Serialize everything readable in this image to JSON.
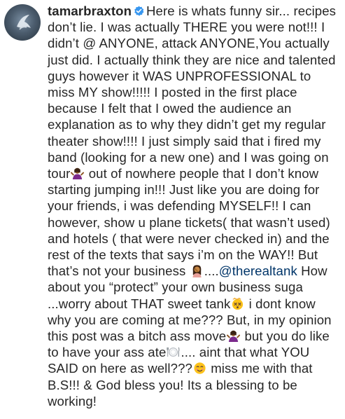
{
  "comment": {
    "username": "tamarbraxton",
    "verified_icon": "verified-badge-icon",
    "accent_color": "#3897f0",
    "mention_color": "#003569",
    "segments": {
      "s1": "Here is whats funny sir... recipes don’t lie. I was actually THERE you were not!!! I didn’t @ ANYONE, attack ANYONE,You actually just did. I actually think they are nice and talented guys however it WAS UNPROFESSIONAL to miss MY show!!!!! I posted in the first place because I felt that I owed the audience an explanation as to why they didn’t get my regular theater show!!!! I just simply said that i fired my band (looking for a new one) and I was going on tour",
      "s2": " out of nowhere people that I don’t know starting jumping in!!! Just like you are doing for your friends, i was defending MYSELF!! I can however, show u plane tickets( that wasn’t used) and hotels ( that were never checked in) and the rest of the texts that says i’m on the WAY!! But that’s not your business ",
      "s3": "....",
      "mention": "@therealtank",
      "s4": " How about you “protect” your own business suga ...worry about THAT sweet tank",
      "s5": " i dont know why you are coming at me??? But, in my opinion this post was a bitch ass move",
      "s6": " but you do like to have your ass ate",
      "s7": ".... aint that what YOU SAID on here as well???",
      "s8": " miss me with that B.S!!! & God bless you! Its a blessing to be working!"
    },
    "emoji_icons": {
      "e1": "woman-shrugging-icon",
      "e2": "woman-facepalming-icon",
      "e3": "dizzy-face-icon",
      "e4": "woman-shrugging-icon",
      "e5": "fork-knife-plate-icon",
      "e6": "smiling-face-icon"
    }
  }
}
